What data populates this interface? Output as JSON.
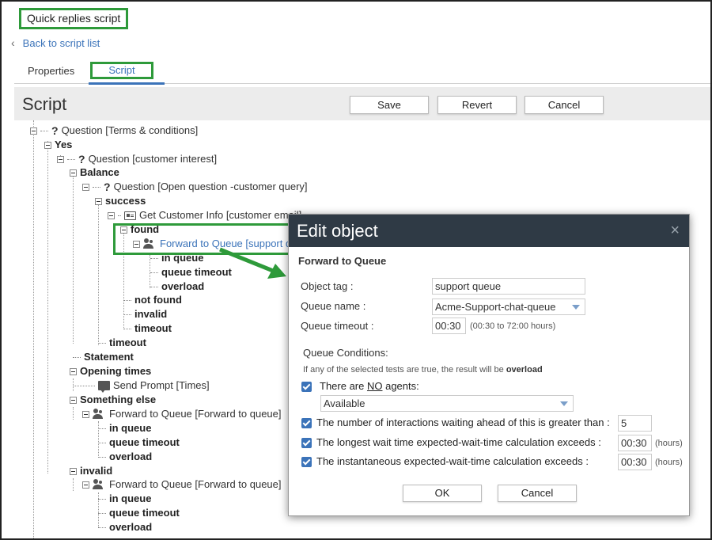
{
  "app_title": "Quick replies script",
  "back_link": "Back to script list",
  "tabs": {
    "properties": "Properties",
    "script": "Script"
  },
  "script_header": {
    "title": "Script",
    "save": "Save",
    "revert": "Revert",
    "cancel": "Cancel"
  },
  "tree": {
    "n1": "Question [Terms & conditions]",
    "n2": "Yes",
    "n3": "Question [customer interest]",
    "n4": "Balance",
    "n5": "Question [Open question -customer query]",
    "n6": "success",
    "n7": "Get Customer Info [customer email]",
    "n8": "found",
    "n9": "Forward to Queue [support queue]",
    "n10": "in queue",
    "n11": "queue timeout",
    "n12": "overload",
    "n13": "not found",
    "n14": "invalid",
    "n15": "timeout",
    "n16": "timeout",
    "n17": "Statement",
    "n18": "Opening times",
    "n19": "Send Prompt [Times]",
    "n20": "Something else",
    "n21": "Forward to Queue [Forward to queue]",
    "n22": "in queue",
    "n23": "queue timeout",
    "n24": "overload",
    "n25": "invalid",
    "n26": "Forward to Queue [Forward to queue]",
    "n27": "in queue",
    "n28": "queue timeout",
    "n29": "overload"
  },
  "dialog": {
    "title": "Edit object",
    "close": "×",
    "subtitle": "Forward to Queue",
    "object_tag_label": "Object tag :",
    "object_tag_value": "support queue",
    "queue_name_label": "Queue name :",
    "queue_name_value": "Acme-Support-chat-queue",
    "queue_timeout_label": "Queue timeout :",
    "queue_timeout_value": "00:30",
    "queue_timeout_hint": "(00:30 to 72:00 hours)",
    "conditions_title": "Queue Conditions:",
    "conditions_note_prefix": "If any of the selected tests are true, the result will be ",
    "conditions_note_bold": "overload",
    "c1_pre": "There are ",
    "c1_no": "NO",
    "c1_post": " agents:",
    "c1_select": "Available",
    "c2_label": "The number of interactions waiting ahead of this is greater than :",
    "c2_value": "5",
    "c3_label": "The longest wait time expected-wait-time calculation exceeds :",
    "c3_value": "00:30",
    "c3_unit": "(hours)",
    "c4_label": "The instantaneous expected-wait-time calculation exceeds :",
    "c4_value": "00:30",
    "c4_unit": "(hours)",
    "ok": "OK",
    "cancel": "Cancel"
  },
  "colors": {
    "highlight": "#2e9a3a",
    "accent": "#3b73b9",
    "dialog_header": "#2f3a45"
  }
}
